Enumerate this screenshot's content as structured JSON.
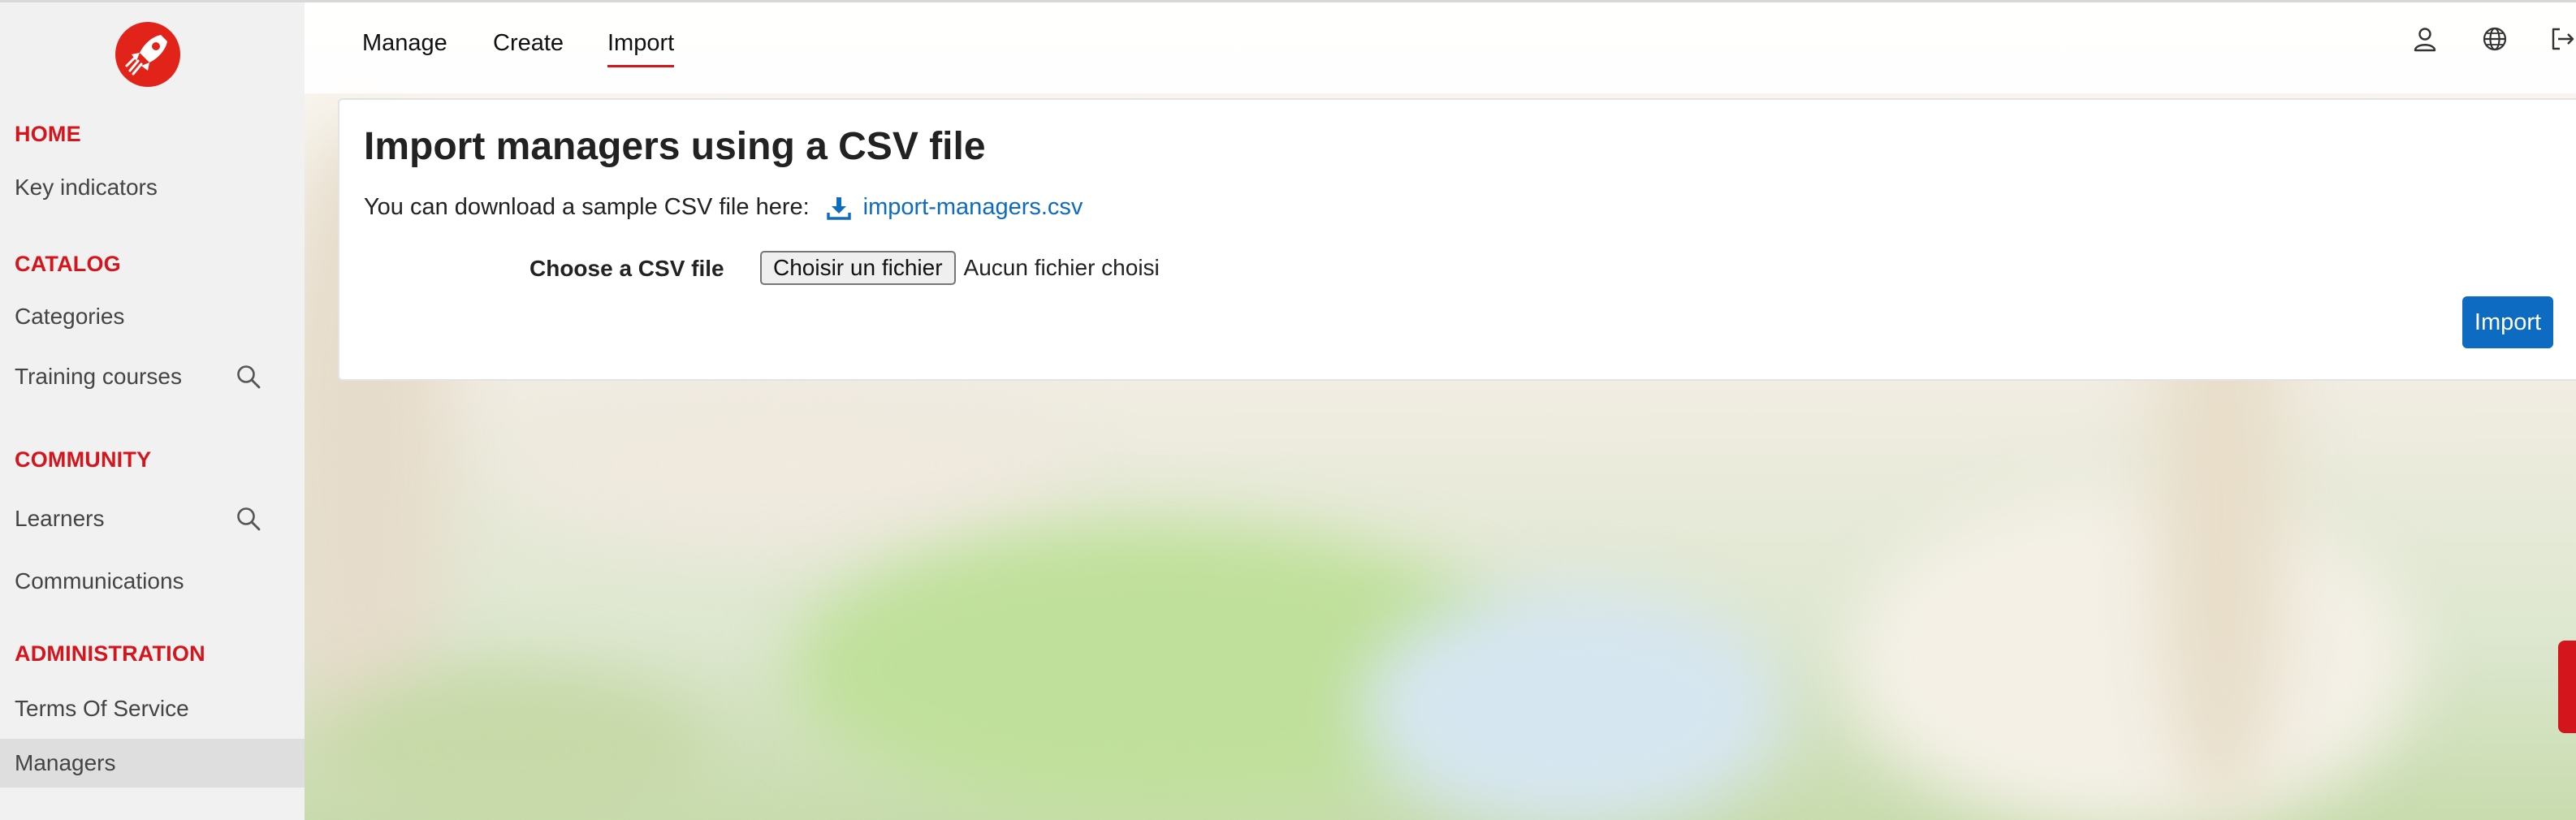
{
  "sidebar": {
    "sections": [
      {
        "title": "HOME",
        "items": [
          {
            "label": "Key indicators",
            "search": false
          }
        ]
      },
      {
        "title": "CATALOG",
        "items": [
          {
            "label": "Categories",
            "search": false
          },
          {
            "label": "Training courses",
            "search": true
          }
        ]
      },
      {
        "title": "COMMUNITY",
        "items": [
          {
            "label": "Learners",
            "search": true
          },
          {
            "label": "Communications",
            "search": false
          }
        ]
      },
      {
        "title": "ADMINISTRATION",
        "items": [
          {
            "label": "Terms Of Service",
            "search": false
          },
          {
            "label": "Managers",
            "search": false,
            "active": true
          }
        ]
      }
    ]
  },
  "topnav": {
    "tabs": [
      {
        "label": "Manage",
        "active": false
      },
      {
        "label": "Create",
        "active": false
      },
      {
        "label": "Import",
        "active": true
      }
    ],
    "icons": [
      "user-icon",
      "globe-icon",
      "logout-icon"
    ]
  },
  "main": {
    "title": "Import managers using a CSV file",
    "sample_text": "You can download a sample CSV file here:",
    "sample_link": "import-managers.csv",
    "file_label": "Choose a CSV file",
    "file_button": "Choisir un fichier",
    "file_status": "Aucun fichier choisi",
    "import_button": "Import"
  },
  "colors": {
    "brand_red": "#d4151c",
    "link_blue": "#0d6bc1",
    "sidebar_bg": "#f1f1f1"
  }
}
